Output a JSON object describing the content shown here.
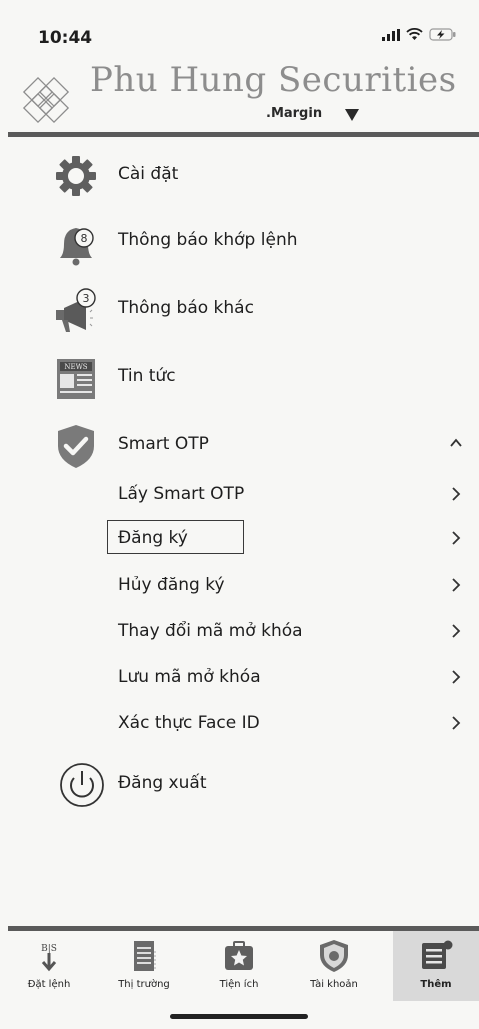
{
  "status": {
    "time": "10:44"
  },
  "header": {
    "brand": "Phu Hung Securities",
    "account_type": ".Margin",
    "logo_icon": "lattice-logo-icon",
    "dropdown_icon": "triangle-down-icon"
  },
  "menu": {
    "items": [
      {
        "label": "Cài đặt",
        "icon": "gear-icon"
      },
      {
        "label": "Thông báo khớp lệnh",
        "icon": "bell-icon",
        "badge": "8"
      },
      {
        "label": "Thông báo khác",
        "icon": "megaphone-icon",
        "badge": "3"
      },
      {
        "label": "Tin tức",
        "icon": "newspaper-icon",
        "icon_text": "NEWS"
      },
      {
        "label": "Smart OTP",
        "icon": "shield-check-icon",
        "expanded": true
      },
      {
        "label": "Đăng xuất",
        "icon": "power-icon"
      }
    ],
    "otp_sub_items": [
      {
        "label": "Lấy Smart OTP"
      },
      {
        "label": "Đăng ký",
        "focused": true
      },
      {
        "label": "Hủy đăng ký"
      },
      {
        "label": "Thay đổi mã mở khóa"
      },
      {
        "label": "Lưu mã mở khóa"
      },
      {
        "label": "Xác thực Face ID"
      }
    ]
  },
  "tabs": [
    {
      "label": "Đặt lệnh",
      "icon": "order-icon",
      "icon_text": "B|S",
      "active": false
    },
    {
      "label": "Thị trường",
      "icon": "market-icon",
      "active": false
    },
    {
      "label": "Tiện ích",
      "icon": "toolbox-icon",
      "active": false
    },
    {
      "label": "Tài khoản",
      "icon": "account-shield-icon",
      "active": false
    },
    {
      "label": "Thêm",
      "icon": "more-icon",
      "active": true
    }
  ],
  "colors": {
    "brand_gray": "#8d8d8d",
    "divider": "#5a5a5a",
    "active_tab": "#d9d9d9",
    "shield": "#7a7a7a"
  }
}
